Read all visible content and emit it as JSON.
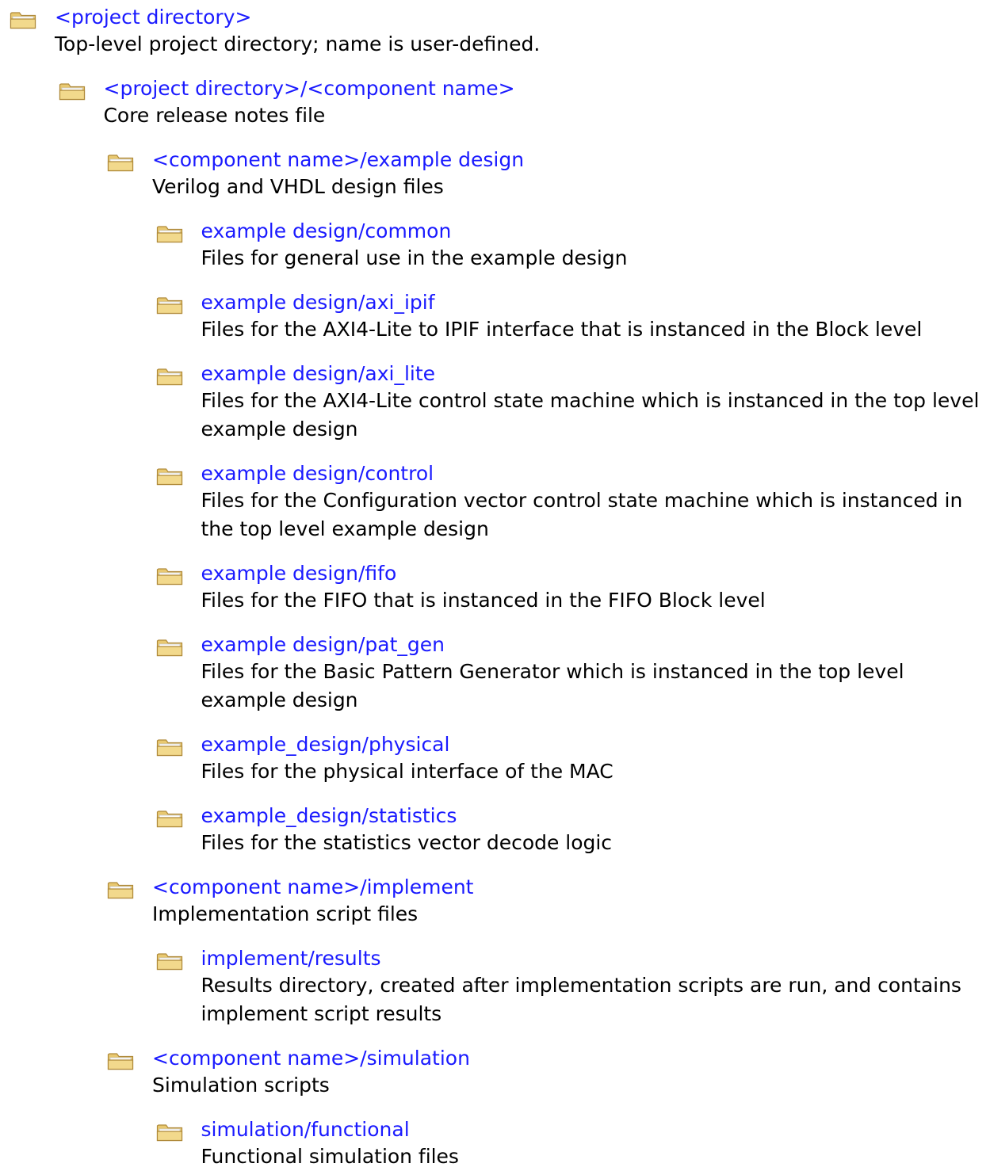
{
  "colors": {
    "link": "#1a1aff",
    "text": "#000000",
    "folder_body": "#f2d98c",
    "folder_edge": "#b08a3a"
  },
  "icon": "folder-icon",
  "nodes": [
    {
      "title": "<project directory>",
      "desc_lines": [
        "Top-level project directory; name is user-defined."
      ],
      "level": 0
    },
    {
      "title": "<project directory>/<component name>",
      "desc_lines": [
        "Core release notes file"
      ],
      "level": 1
    },
    {
      "title": "<component name>/example design",
      "desc_lines": [
        "Verilog and VHDL design files"
      ],
      "level": 2
    },
    {
      "title": "example design/common",
      "desc_lines": [
        "Files for general use in the example design"
      ],
      "level": 3
    },
    {
      "title": "example design/axi_ipif",
      "desc_lines": [
        "Files for the AXI4-Lite to IPIF interface that is instanced in the Block level"
      ],
      "level": 3
    },
    {
      "title": "example design/axi_lite",
      "desc_lines": [
        "Files for the AXI4-Lite control state machine which is instanced in the top level",
        "example design"
      ],
      "level": 3
    },
    {
      "title": "example design/control",
      "desc_lines": [
        "Files for the Configuration vector control state machine which is instanced in",
        "the top level example design"
      ],
      "level": 3
    },
    {
      "title": "example design/fifo",
      "desc_lines": [
        "Files for the FIFO that is instanced in the FIFO Block level"
      ],
      "level": 3
    },
    {
      "title": "example design/pat_gen",
      "desc_lines": [
        "Files for the Basic Pattern Generator which is instanced in the top level",
        "example design"
      ],
      "level": 3
    },
    {
      "title": "example_design/physical",
      "desc_lines": [
        "Files for the physical interface of the MAC"
      ],
      "level": 3
    },
    {
      "title": "example_design/statistics",
      "desc_lines": [
        "Files for the statistics vector decode logic"
      ],
      "level": 3
    },
    {
      "title": "<component name>/implement",
      "desc_lines": [
        "Implementation script files"
      ],
      "level": 2
    },
    {
      "title": "implement/results",
      "desc_lines": [
        "Results directory, created after implementation scripts are run, and contains",
        "implement script results"
      ],
      "level": 3
    },
    {
      "title": "<component name>/simulation",
      "desc_lines": [
        "Simulation scripts"
      ],
      "level": 2
    },
    {
      "title": "simulation/functional",
      "desc_lines": [
        "Functional simulation files"
      ],
      "level": 3
    }
  ]
}
